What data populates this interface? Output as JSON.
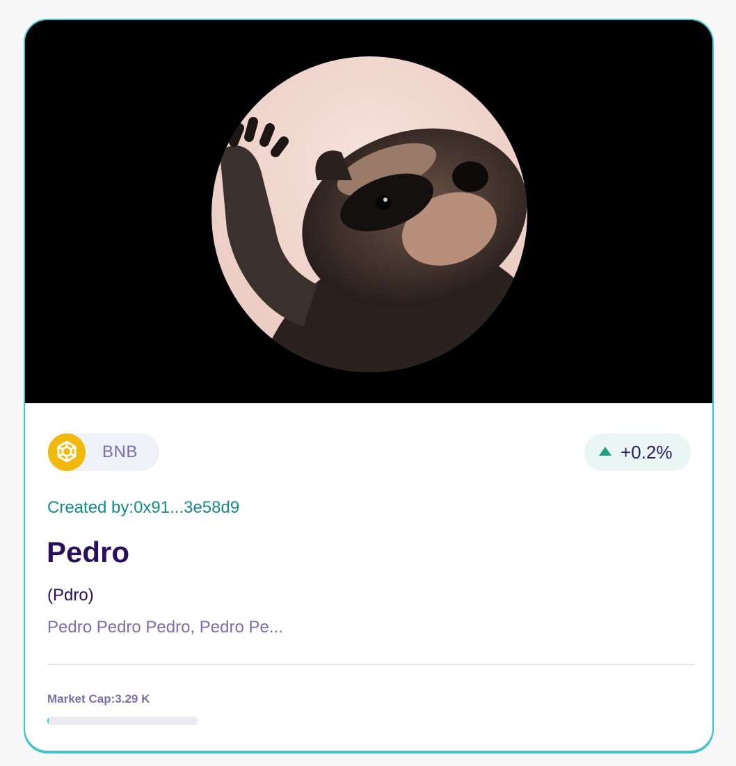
{
  "card": {
    "image_subject": "raccoon-avatar",
    "chain": {
      "icon": "bnb-icon",
      "label": "BNB"
    },
    "price_change": {
      "direction": "up",
      "value": "+0.2%"
    },
    "creator": "Created by:0x91...3e58d9",
    "name": "Pedro",
    "symbol": "(Pdro)",
    "description": "Pedro Pedro Pedro, Pedro Pe...",
    "market_cap": "Market Cap:3.29 K",
    "progress_fraction": 0.01
  },
  "colors": {
    "border": "#3cc4cf",
    "accent_teal": "#138a8a",
    "up_green": "#1fa583",
    "title": "#2a0f5c",
    "muted_purple": "#7b6ea8",
    "bnb_yellow": "#f0b90b"
  }
}
